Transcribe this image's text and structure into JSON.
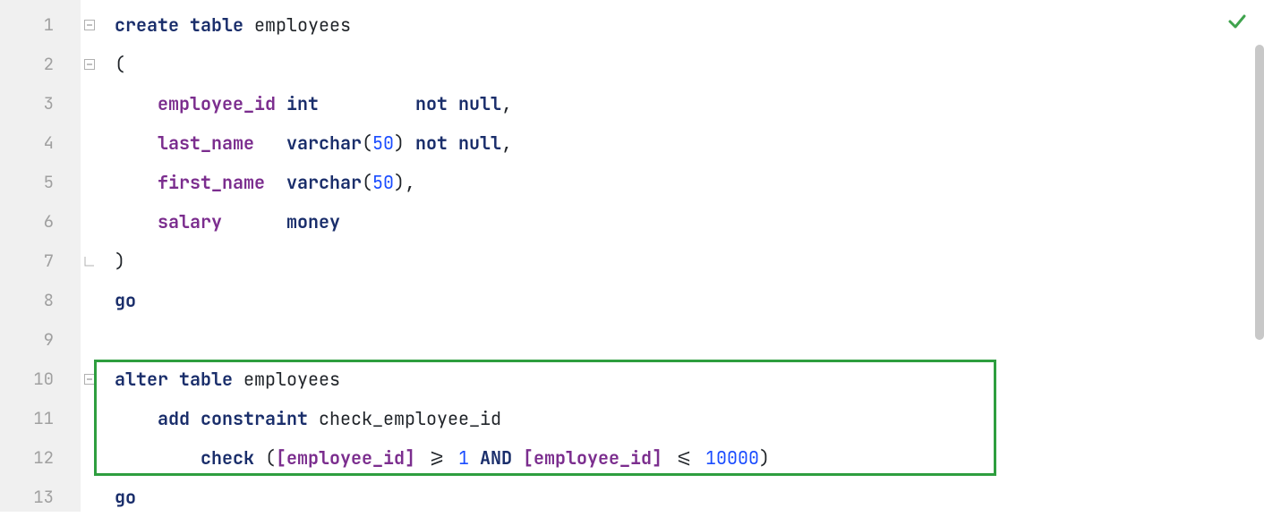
{
  "gutter": {
    "lines": [
      "1",
      "2",
      "3",
      "4",
      "5",
      "6",
      "7",
      "8",
      "9",
      "10",
      "11",
      "12",
      "13"
    ]
  },
  "fold": {
    "marks": [
      true,
      true,
      false,
      false,
      false,
      false,
      true,
      false,
      false,
      true,
      false,
      false,
      false
    ]
  },
  "code": {
    "l1": {
      "kw1": "create",
      "kw2": "table",
      "id": "employees"
    },
    "l2": {
      "p": "("
    },
    "l3": {
      "col": "employee_id",
      "type": "int",
      "nn1": "not",
      "nn2": "null",
      "comma": ","
    },
    "l4": {
      "col": "last_name",
      "type": "varchar",
      "open": "(",
      "n": "50",
      "close": ")",
      "nn1": "not",
      "nn2": "null",
      "comma": ","
    },
    "l5": {
      "col": "first_name",
      "type": "varchar",
      "open": "(",
      "n": "50",
      "close": ")",
      "comma": ","
    },
    "l6": {
      "col": "salary",
      "type": "money"
    },
    "l7": {
      "p": ")"
    },
    "l8": {
      "go": "go"
    },
    "l9": {
      "blank": ""
    },
    "l10": {
      "kw1": "alter",
      "kw2": "table",
      "id": "employees"
    },
    "l11": {
      "kw1": "add",
      "kw2": "constraint",
      "name": "check_employee_id"
    },
    "l12": {
      "kw": "check",
      "open": " (",
      "br1": "[employee_id]",
      "op1": " >= ",
      "n1": "1",
      "and": " AND ",
      "br2": "[employee_id]",
      "op2": " <= ",
      "n2": "10000",
      "close": ")"
    },
    "l13": {
      "go": "go"
    }
  },
  "status": {
    "ok_icon": "check"
  }
}
